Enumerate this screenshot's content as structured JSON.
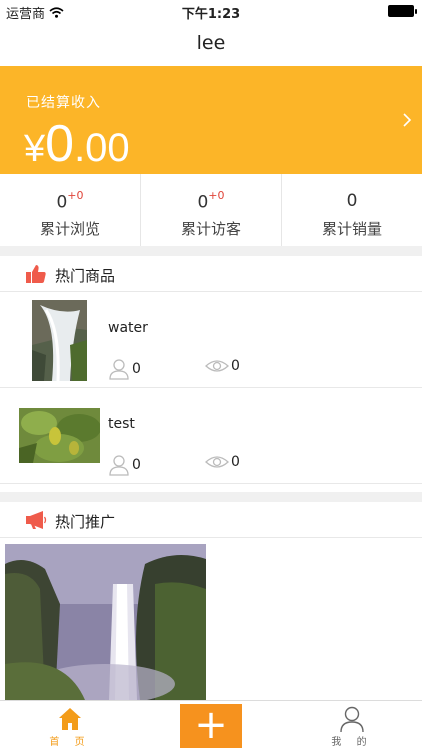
{
  "status_bar": {
    "carrier": "运营商",
    "time": "下午1:23"
  },
  "nav": {
    "title": "lee"
  },
  "income": {
    "label": "已结算收入",
    "currency": "¥",
    "integer": "0",
    "decimal": ".00"
  },
  "stats": [
    {
      "value": "0",
      "delta": "+0",
      "label": "累计浏览"
    },
    {
      "value": "0",
      "delta": "+0",
      "label": "累计访客"
    },
    {
      "value": "0",
      "delta": "",
      "label": "累计销量"
    }
  ],
  "hot_products": {
    "title": "热门商品",
    "items": [
      {
        "name": "water",
        "likes": "0",
        "views": "0"
      },
      {
        "name": "test",
        "likes": "0",
        "views": "0"
      }
    ]
  },
  "hot_promo": {
    "title": "热门推广"
  },
  "tabs": {
    "home": "首 页",
    "mine": "我 的",
    "add": "+"
  },
  "colors": {
    "accent": "#fcb528",
    "add_button": "#f6921e",
    "delta": "#e0453a",
    "section_icon": "#ef5b4b"
  }
}
